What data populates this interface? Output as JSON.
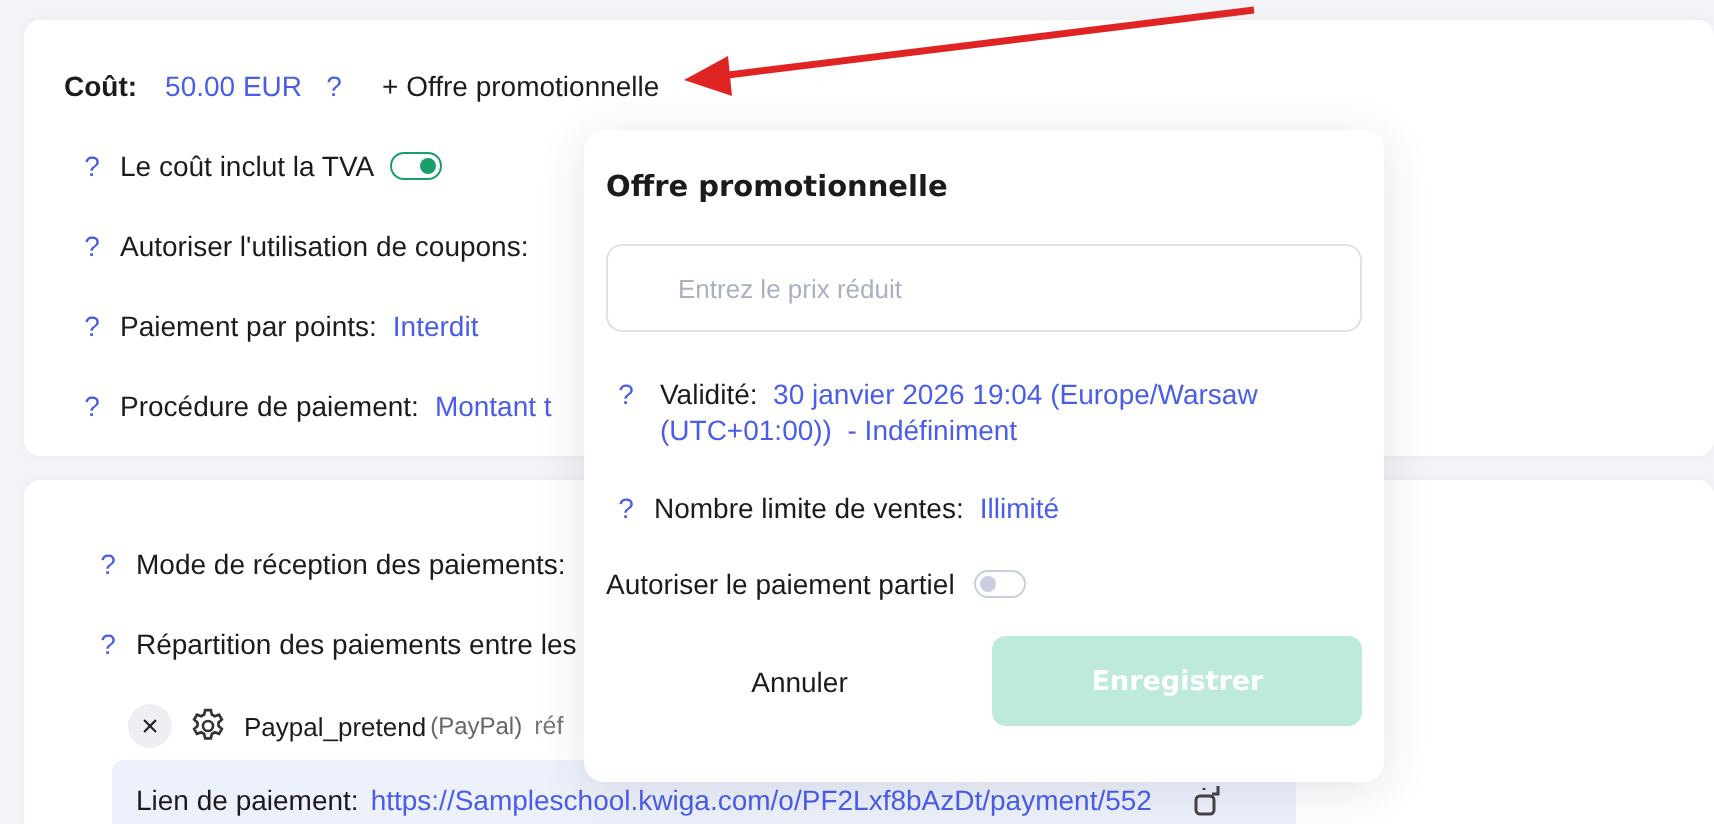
{
  "cost": {
    "label": "Coût:",
    "value": "50.00 EUR",
    "help": "?",
    "promo_link": "+ Offre promotionnelle"
  },
  "settings": [
    {
      "kind": "toggle",
      "help": "?",
      "label": "Le coût inclut la TVA",
      "on": true
    },
    {
      "kind": "text",
      "help": "?",
      "label": "Autoriser l'utilisation de coupons:"
    },
    {
      "kind": "value",
      "help": "?",
      "label": "Paiement par points:",
      "value": "Interdit"
    },
    {
      "kind": "value",
      "help": "?",
      "label": "Procédure de paiement:",
      "value": "Montant t"
    }
  ],
  "payments": {
    "rows": [
      {
        "help": "?",
        "label": "Mode de réception des paiements:"
      },
      {
        "help": "?",
        "label": "Répartition des paiements entre les"
      }
    ],
    "method": {
      "remove": "×",
      "name": "Paypal_pretend",
      "provider": "(PayPal)",
      "note": "réf"
    },
    "link": {
      "label": "Lien de paiement:",
      "url": "https://Sampleschool.kwiga.com/o/PF2Lxf8bAzDt/payment/552"
    }
  },
  "popup": {
    "title": "Offre promotionnelle",
    "price_field": {
      "placeholder": "Entrez le prix réduit"
    },
    "validity": {
      "help": "?",
      "label": "Validité:",
      "value": "30 janvier 2026 19:04 (Europe/Warsaw (UTC+01:00))",
      "suffix": "- Indéfiniment"
    },
    "sales_limit": {
      "help": "?",
      "label": "Nombre limite de ventes:",
      "value": "Illimité"
    },
    "partial_payment": {
      "label": "Autoriser le paiement partiel",
      "on": false
    },
    "buttons": [
      {
        "kind": "cancel",
        "label": "Annuler",
        "disabled": false
      },
      {
        "kind": "save",
        "label": "Enregistrer",
        "disabled": true
      }
    ]
  }
}
